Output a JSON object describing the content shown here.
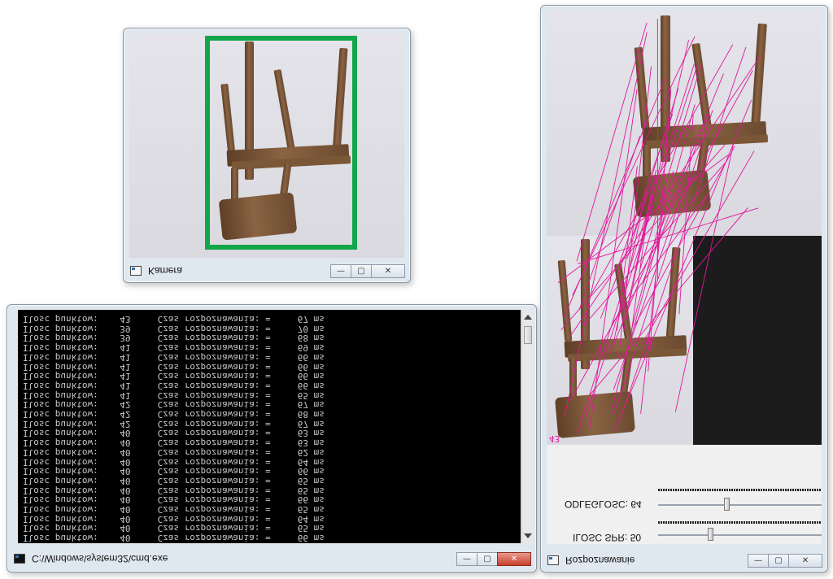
{
  "camera_window": {
    "title": "Kamera",
    "icon": "window-app-icon",
    "minimize_symbol": "—",
    "maximize_symbol": "▢",
    "close_symbol": "✕",
    "detection_box_color": "#12a64a"
  },
  "console_window": {
    "title": "C:\\Windows\\system32\\cmd.exe",
    "icon": "cmd-icon",
    "minimize_symbol": "—",
    "maximize_symbol": "▢",
    "close_symbol": "✕",
    "lines": [
      "Ilosc punktow:    43     Czas rozpoznawania: =     67 ms",
      "Ilosc punktow:    39     Czas rozpoznawania: =     70 ms",
      "Ilosc punktow:    39     Czas rozpoznawania: =     68 ms",
      "Ilosc punktow:    41     Czas rozpoznawania: =     69 ms",
      "Ilosc punktow:    41     Czas rozpoznawania: =     66 ms",
      "Ilosc punktow:    41     Czas rozpoznawania: =     66 ms",
      "Ilosc punktow:    41     Czas rozpoznawania: =     66 ms",
      "Ilosc punktow:    41     Czas rozpoznawania: =     66 ms",
      "Ilosc punktow:    41     Czas rozpoznawania: =     65 ms",
      "Ilosc punktow:    42     Czas rozpoznawania: =     67 ms",
      "Ilosc punktow:    42     Czas rozpoznawania: =     68 ms",
      "Ilosc punktow:    42     Czas rozpoznawania: =     67 ms",
      "Ilosc punktow:    40     Czas rozpoznawania: =     63 ms",
      "Ilosc punktow:    40     Czas rozpoznawania: =     63 ms",
      "Ilosc punktow:    40     Czas rozpoznawania: =     62 ms",
      "Ilosc punktow:    40     Czas rozpoznawania: =     64 ms",
      "Ilosc punktow:    40     Czas rozpoznawania: =     66 ms",
      "Ilosc punktow:    40     Czas rozpoznawania: =     65 ms",
      "Ilosc punktow:    40     Czas rozpoznawania: =     65 ms",
      "Ilosc punktow:    40     Czas rozpoznawania: =     66 ms",
      "Ilosc punktow:    40     Czas rozpoznawania: =     65 ms",
      "Ilosc punktow:    40     Czas rozpoznawania: =     64 ms",
      "Ilosc punktow:    40     Czas rozpoznawania: =     65 ms",
      "Ilosc punktow:    40     Czas rozpoznawania: =     66 ms"
    ]
  },
  "recognition_window": {
    "title": "Rozpoznawanie",
    "icon": "window-app-icon",
    "minimize_symbol": "—",
    "maximize_symbol": "▢",
    "close_symbol": "✕",
    "match_count_label": "43",
    "match_line_color": "#e0189a",
    "trackbars": [
      {
        "label": "ODLEGLOSC: 64",
        "value": 64
      },
      {
        "label": "ILOSC SPR: 50",
        "value": 50
      }
    ]
  }
}
